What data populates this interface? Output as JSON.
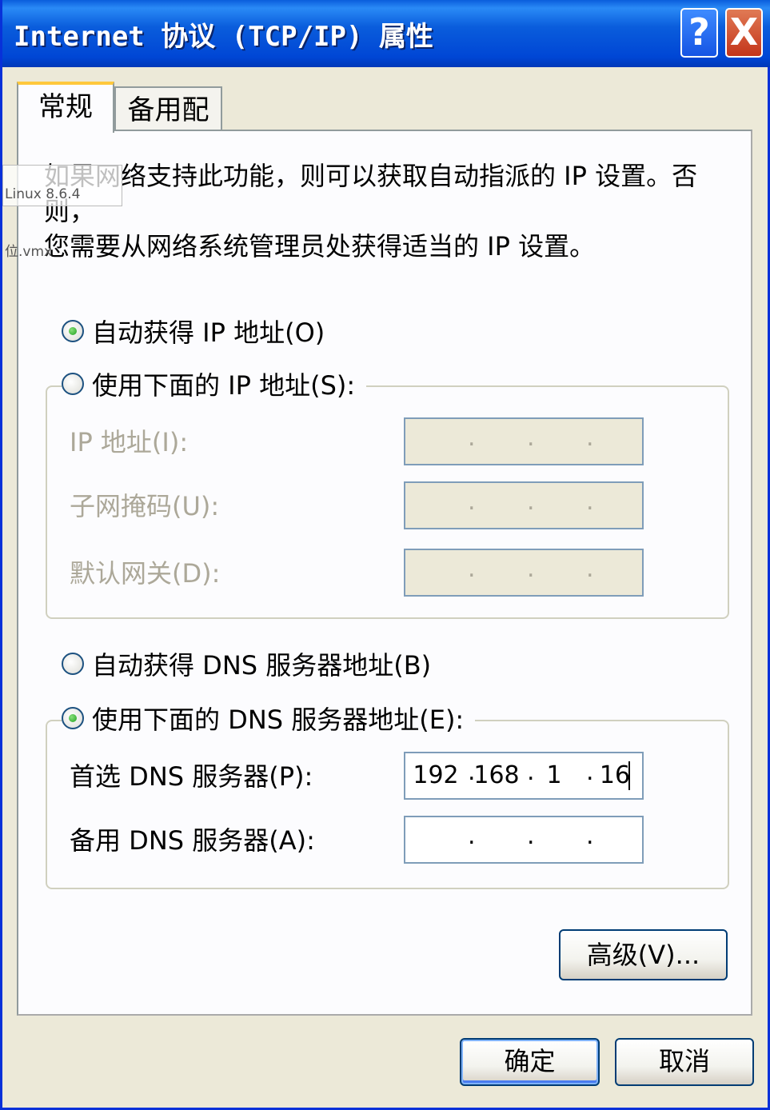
{
  "window": {
    "title": "Internet 协议 (TCP/IP) 属性",
    "help_glyph": "?",
    "close_glyph": "X"
  },
  "tabs": [
    {
      "label": "常规",
      "active": true
    },
    {
      "label": "备用配置",
      "active": false
    }
  ],
  "overlay_text": "Linux 8.6.4 位.vmx",
  "description": {
    "line1": "如果网络支持此功能，则可以获取自动指派的 IP 设置。否则，",
    "line2": "您需要从网络系统管理员处获得适当的 IP 设置。"
  },
  "ip_section": {
    "auto_option": {
      "label": "自动获得 IP 地址(O)",
      "checked": true
    },
    "manual_option": {
      "label": "使用下面的 IP 地址(S):",
      "checked": false
    },
    "fields": [
      {
        "label": "IP 地址(I):",
        "octets": [
          "",
          "",
          "",
          ""
        ]
      },
      {
        "label": "子网掩码(U):",
        "octets": [
          "",
          "",
          "",
          ""
        ]
      },
      {
        "label": "默认网关(D):",
        "octets": [
          "",
          "",
          "",
          ""
        ]
      }
    ]
  },
  "dns_section": {
    "auto_option": {
      "label": "自动获得 DNS 服务器地址(B)",
      "checked": false
    },
    "manual_option": {
      "label": "使用下面的 DNS 服务器地址(E):",
      "checked": true
    },
    "fields": [
      {
        "label": "首选 DNS 服务器(P):",
        "octets": [
          "192",
          "168",
          "1",
          "16"
        ]
      },
      {
        "label": "备用 DNS 服务器(A):",
        "octets": [
          "",
          "",
          "",
          ""
        ]
      }
    ]
  },
  "buttons": {
    "advanced": "高级(V)...",
    "ok": "确定",
    "cancel": "取消"
  },
  "colors": {
    "title_bar": "#0a5ddc",
    "dialog_bg": "#ece9d8",
    "tab_highlight": "#ffc83c",
    "disabled_text": "#aca899"
  }
}
